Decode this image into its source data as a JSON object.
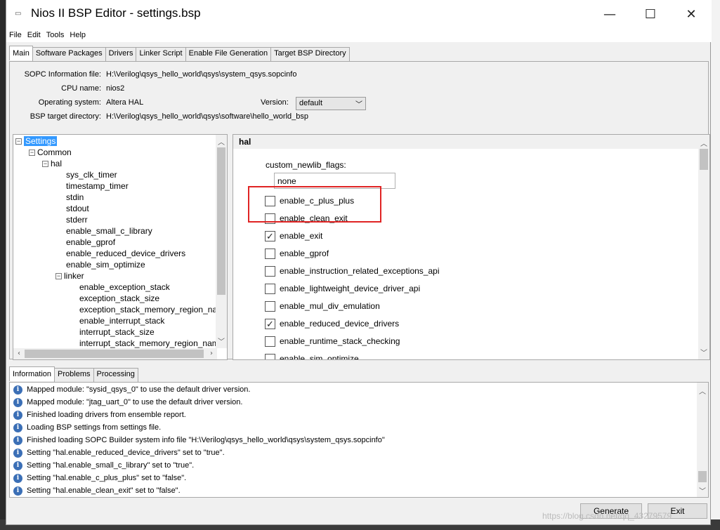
{
  "window": {
    "title": "Nios II BSP Editor - settings.bsp",
    "controls": {
      "minimize": "—",
      "maximize": "☐",
      "close": "✕"
    }
  },
  "menu": [
    "File",
    "Edit",
    "Tools",
    "Help"
  ],
  "tabs": [
    "Main",
    "Software Packages",
    "Drivers",
    "Linker Script",
    "Enable File Generation",
    "Target BSP Directory"
  ],
  "info": {
    "sopc_label": "SOPC Information file:",
    "sopc_value": "H:\\Verilog\\qsys_hello_world\\qsys\\system_qsys.sopcinfo",
    "cpu_label": "CPU name:",
    "cpu_value": "nios2",
    "os_label": "Operating system:",
    "os_value": "Altera HAL",
    "version_label": "Version:",
    "version_value": "default",
    "bsp_label": "BSP target directory:",
    "bsp_value": "H:\\Verilog\\qsys_hello_world\\qsys\\software\\hello_world_bsp"
  },
  "tree": {
    "root": "Settings",
    "common": "Common",
    "hal": "hal",
    "hal_items": [
      "sys_clk_timer",
      "timestamp_timer",
      "stdin",
      "stdout",
      "stderr",
      "enable_small_c_library",
      "enable_gprof",
      "enable_reduced_device_drivers",
      "enable_sim_optimize"
    ],
    "linker": "linker",
    "linker_items": [
      "enable_exception_stack",
      "exception_stack_size",
      "exception_stack_memory_region_name",
      "enable_interrupt_stack",
      "interrupt_stack_size",
      "interrupt_stack_memory_region_name"
    ]
  },
  "hal_panel": {
    "header": "hal",
    "newlib_label": "custom_newlib_flags:",
    "newlib_value": "none",
    "options": [
      {
        "label": "enable_c_plus_plus",
        "checked": false
      },
      {
        "label": "enable_clean_exit",
        "checked": false
      },
      {
        "label": "enable_exit",
        "checked": true
      },
      {
        "label": "enable_gprof",
        "checked": false
      },
      {
        "label": "enable_instruction_related_exceptions_api",
        "checked": false
      },
      {
        "label": "enable_lightweight_device_driver_api",
        "checked": false
      },
      {
        "label": "enable_mul_div_emulation",
        "checked": false
      },
      {
        "label": "enable_reduced_device_drivers",
        "checked": true
      },
      {
        "label": "enable_runtime_stack_checking",
        "checked": false
      },
      {
        "label": "enable_sim_optimize",
        "checked": false
      }
    ]
  },
  "bottom_tabs": [
    "Information",
    "Problems",
    "Processing"
  ],
  "log": [
    "Mapped module: \"sysid_qsys_0\" to use the default driver version.",
    "Mapped module: \"jtag_uart_0\" to use the default driver version.",
    "Finished loading drivers from ensemble report.",
    "Loading BSP settings from settings file.",
    "Finished loading SOPC Builder system info file \"H:\\Verilog\\qsys_hello_world\\qsys\\system_qsys.sopcinfo\"",
    "Setting \"hal.enable_reduced_device_drivers\" set to \"true\".",
    "Setting \"hal.enable_small_c_library\" set to \"true\".",
    "Setting \"hal.enable_c_plus_plus\" set to \"false\".",
    "Setting \"hal.enable_clean_exit\" set to \"false\"."
  ],
  "buttons": {
    "generate": "Generate",
    "exit": "Exit"
  },
  "watermark": "https://blog.csdn.net/qq_43279579",
  "colors": {
    "selection": "#3399ff",
    "highlight_box": "#e02424",
    "info_icon": "#3b6fb6"
  }
}
